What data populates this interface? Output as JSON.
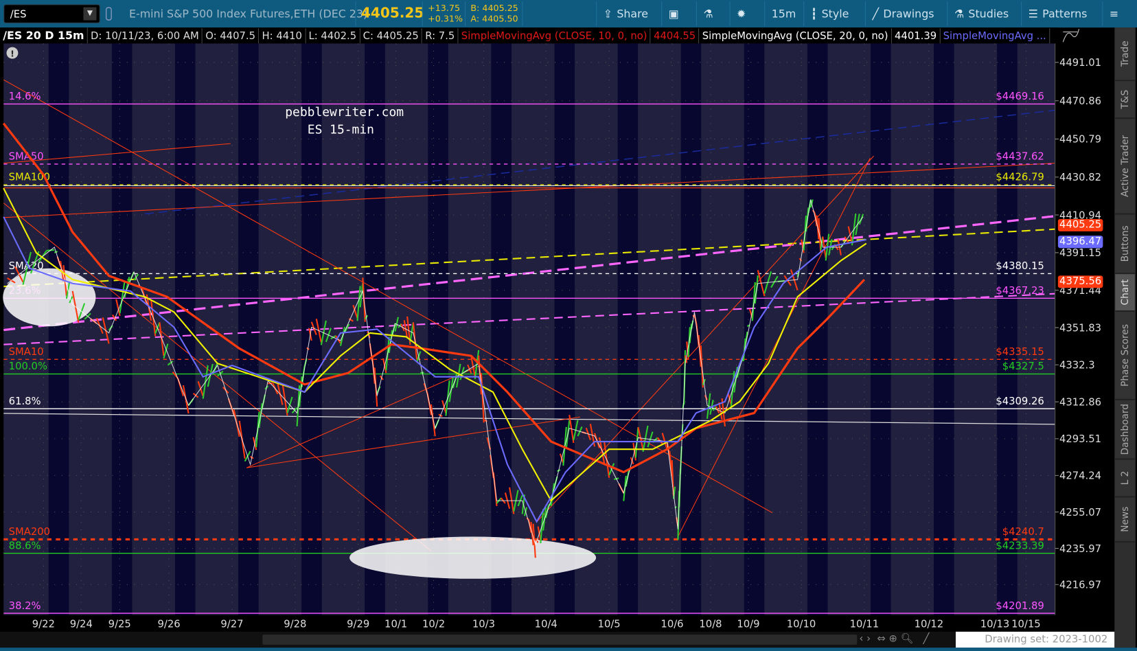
{
  "toolbar": {
    "symbol": "/ES",
    "description": "E-mini S&P 500 Index Futures,ETH (DEC 23)",
    "last": "4405.25",
    "change": "+13.75",
    "change_pct": "+0.31%",
    "bid": "B: 4405.25",
    "ask": "A: 4405.50",
    "buttons": [
      {
        "label": "Share",
        "icon": "share-icon"
      },
      {
        "label": "",
        "icon": "alert-icon"
      },
      {
        "label": "",
        "icon": "flask-icon"
      },
      {
        "label": "",
        "icon": "gear-icon"
      },
      {
        "label": "15m",
        "icon": ""
      },
      {
        "label": "Style",
        "icon": "candle-icon"
      },
      {
        "label": "Drawings",
        "icon": "pen-icon"
      },
      {
        "label": "Studies",
        "icon": "flask-icon"
      },
      {
        "label": "Patterns",
        "icon": "pattern-icon"
      },
      {
        "label": "",
        "icon": "menu-icon"
      }
    ]
  },
  "info": {
    "symbol": "/ES 20 D 15m",
    "date": "D: 10/11/23, 6:00 AM",
    "open": "O: 4407.5",
    "high": "H: 4410",
    "low": "L: 4402.5",
    "close": "C: 4405.25",
    "range": "R: 7.5",
    "sma10_label": "SimpleMovingAvg (CLOSE, 10, 0, no)",
    "sma10_value": "4404.55",
    "sma20_label": "SimpleMovingAvg (CLOSE, 20, 0, no)",
    "sma20_value": "4401.39",
    "sma3_label": "SimpleMovingAvg ..."
  },
  "watermark": {
    "line1": "pebblewriter.com",
    "line2": "ES 15-min"
  },
  "price_axis": [
    "4491.01",
    "4470.86",
    "4450.79",
    "4430.82",
    "4410.94",
    "4391.15",
    "4371.44",
    "4351.83",
    "4332.3",
    "4312.86",
    "4293.51",
    "4274.24",
    "4255.07",
    "4235.97",
    "4216.97"
  ],
  "price_tags": [
    {
      "value": "4405.25",
      "color": "#ff3a10"
    },
    {
      "value": "4396.47",
      "color": "#6b6bff"
    },
    {
      "value": "4375.56",
      "color": "#ff3a10"
    }
  ],
  "time_axis": [
    "9/22",
    "9/24",
    "9/25",
    "9/26",
    "9/27",
    "9/28",
    "9/29",
    "10/1",
    "10/2",
    "10/3",
    "10/4",
    "10/5",
    "10/6",
    "10/8",
    "10/9",
    "10/10",
    "10/11",
    "10/12",
    "10/13",
    "10/15"
  ],
  "levels": [
    {
      "left": "14.6%",
      "right": "$4469.16",
      "price": 4469.16,
      "color": "#ff55ff",
      "label_color": "#ff55ff",
      "style": "solid"
    },
    {
      "left": "SMA50",
      "right": "$4437.62",
      "price": 4437.62,
      "color": "#ff55ff",
      "label_color": "#ff55ff",
      "style": "dash"
    },
    {
      "left": "SMA100",
      "right": "$4426.79",
      "price": 4426.79,
      "color": "#e8e800",
      "label_color": "#e8e800",
      "style": "dash"
    },
    {
      "left": "SMA20",
      "right": "$4380.15",
      "price": 4380.15,
      "color": "#ffffff",
      "label_color": "#ffffff",
      "style": "dash"
    },
    {
      "left": "23.6%",
      "right": "$4367.23",
      "price": 4367.23,
      "color": "#ff55ff",
      "label_color": "#ff55ff",
      "style": "solid"
    },
    {
      "left": "SMA10",
      "right": "$4335.15",
      "price": 4335.15,
      "color": "#ff3a10",
      "label_color": "#ff3a10",
      "style": "dash"
    },
    {
      "left": "100.0%",
      "right": "$4327.5",
      "price": 4327.5,
      "color": "#22cc22",
      "label_color": "#22cc22",
      "style": "solid"
    },
    {
      "left": "61.8%",
      "right": "$4309.26",
      "price": 4309.26,
      "color": "#ffffff",
      "label_color": "#ffffff",
      "style": "solid"
    },
    {
      "left": "SMA200",
      "right": "$4240.7",
      "price": 4240.7,
      "color": "#ff3a10",
      "label_color": "#ff3a10",
      "style": "dot"
    },
    {
      "left": "88.6%",
      "right": "$4233.39",
      "price": 4233.39,
      "color": "#22cc22",
      "label_color": "#22cc22",
      "style": "solid"
    },
    {
      "left": "38.2%",
      "right": "$4201.89",
      "price": 4201.89,
      "color": "#ff55ff",
      "label_color": "#ff55ff",
      "style": "solid"
    }
  ],
  "chart_data": {
    "type": "line",
    "title": "/ES 20 D 15m",
    "price_range": [
      4195,
      4510
    ],
    "series": [
      {
        "name": "Price",
        "color": "#33cc33",
        "points": [
          [
            -0.96,
            4375
          ],
          [
            0.29,
            4394
          ],
          [
            0.77,
            4364
          ],
          [
            1.72,
            4349
          ],
          [
            2.29,
            4381
          ],
          [
            2.81,
            4349
          ],
          [
            3.31,
            4311
          ],
          [
            3.77,
            4332
          ],
          [
            4.29,
            4280
          ],
          [
            4.57,
            4324
          ],
          [
            5.03,
            4307
          ],
          [
            5.26,
            4352
          ],
          [
            5.72,
            4345
          ],
          [
            6.12,
            4371
          ],
          [
            6.5,
            4316
          ],
          [
            6.98,
            4354
          ],
          [
            7.46,
            4349
          ],
          [
            8.03,
            4299
          ],
          [
            8.46,
            4326
          ],
          [
            8.9,
            4333
          ],
          [
            9.21,
            4261
          ],
          [
            9.62,
            4261
          ],
          [
            9.83,
            4238
          ],
          [
            10.08,
            4261
          ],
          [
            10.37,
            4299
          ],
          [
            10.77,
            4295
          ],
          [
            11.23,
            4265
          ],
          [
            11.46,
            4294
          ],
          [
            11.92,
            4292
          ],
          [
            12.15,
            4246
          ],
          [
            12.34,
            4333
          ],
          [
            12.58,
            4360
          ],
          [
            12.91,
            4311
          ],
          [
            13.38,
            4307
          ],
          [
            13.87,
            4337
          ],
          [
            14.18,
            4375
          ],
          [
            14.93,
            4377
          ],
          [
            15.15,
            4419
          ],
          [
            15.34,
            4394
          ],
          [
            15.63,
            4394
          ],
          [
            15.98,
            4410
          ]
        ]
      },
      {
        "name": "SMA red",
        "color": "#ff3a10",
        "points": [
          [
            -1.06,
            4459
          ],
          [
            0,
            4432
          ],
          [
            0.77,
            4402
          ],
          [
            1.72,
            4379
          ],
          [
            2.96,
            4368
          ],
          [
            4.11,
            4341
          ],
          [
            5.15,
            4322
          ],
          [
            5.84,
            4328
          ],
          [
            6.88,
            4343
          ],
          [
            7.65,
            4341
          ],
          [
            8.75,
            4337
          ],
          [
            9.38,
            4318
          ],
          [
            10.08,
            4292
          ],
          [
            11.23,
            4276
          ],
          [
            11.92,
            4288
          ],
          [
            12.62,
            4299
          ],
          [
            14.11,
            4307
          ],
          [
            14.93,
            4341
          ],
          [
            15.4,
            4356
          ],
          [
            16,
            4377
          ]
        ]
      },
      {
        "name": "SMA yellow",
        "color": "#f0f000",
        "points": [
          [
            -1.06,
            4425
          ],
          [
            -0.19,
            4391
          ],
          [
            0.77,
            4377
          ],
          [
            2.51,
            4368
          ],
          [
            3.08,
            4360
          ],
          [
            3.77,
            4333
          ],
          [
            5.15,
            4318
          ],
          [
            5.72,
            4337
          ],
          [
            6.31,
            4349
          ],
          [
            7.27,
            4347
          ],
          [
            8.32,
            4330
          ],
          [
            9.15,
            4318
          ],
          [
            9.62,
            4288
          ],
          [
            10.08,
            4261
          ],
          [
            11,
            4288
          ],
          [
            11.69,
            4288
          ],
          [
            13,
            4303
          ],
          [
            13.77,
            4313
          ],
          [
            14.38,
            4333
          ],
          [
            14.93,
            4368
          ],
          [
            15.63,
            4387
          ],
          [
            16.03,
            4396
          ]
        ]
      },
      {
        "name": "SMA blue",
        "color": "#6b6bff",
        "points": [
          [
            -1.06,
            4410
          ],
          [
            -0.38,
            4383
          ],
          [
            0.77,
            4375
          ],
          [
            2.22,
            4371
          ],
          [
            3.08,
            4352
          ],
          [
            3.54,
            4326
          ],
          [
            4,
            4332
          ],
          [
            5.15,
            4318
          ],
          [
            5.72,
            4349
          ],
          [
            6.5,
            4351
          ],
          [
            8.03,
            4326
          ],
          [
            8.9,
            4326
          ],
          [
            9.38,
            4280
          ],
          [
            9.85,
            4250
          ],
          [
            10.31,
            4276
          ],
          [
            10.77,
            4292
          ],
          [
            12.15,
            4292
          ],
          [
            12.62,
            4307
          ],
          [
            13.38,
            4313
          ],
          [
            14.11,
            4352
          ],
          [
            14.66,
            4375
          ],
          [
            15.4,
            4394
          ],
          [
            16.03,
            4398
          ]
        ]
      }
    ]
  },
  "side_tabs": [
    "Trade",
    "T&S",
    "Active Trader",
    "Buttons",
    "Chart",
    "Phase Scores",
    "Dashboard",
    "L 2",
    "News"
  ],
  "footer": {
    "drawing_set": "Drawing set: 2023-1002"
  }
}
